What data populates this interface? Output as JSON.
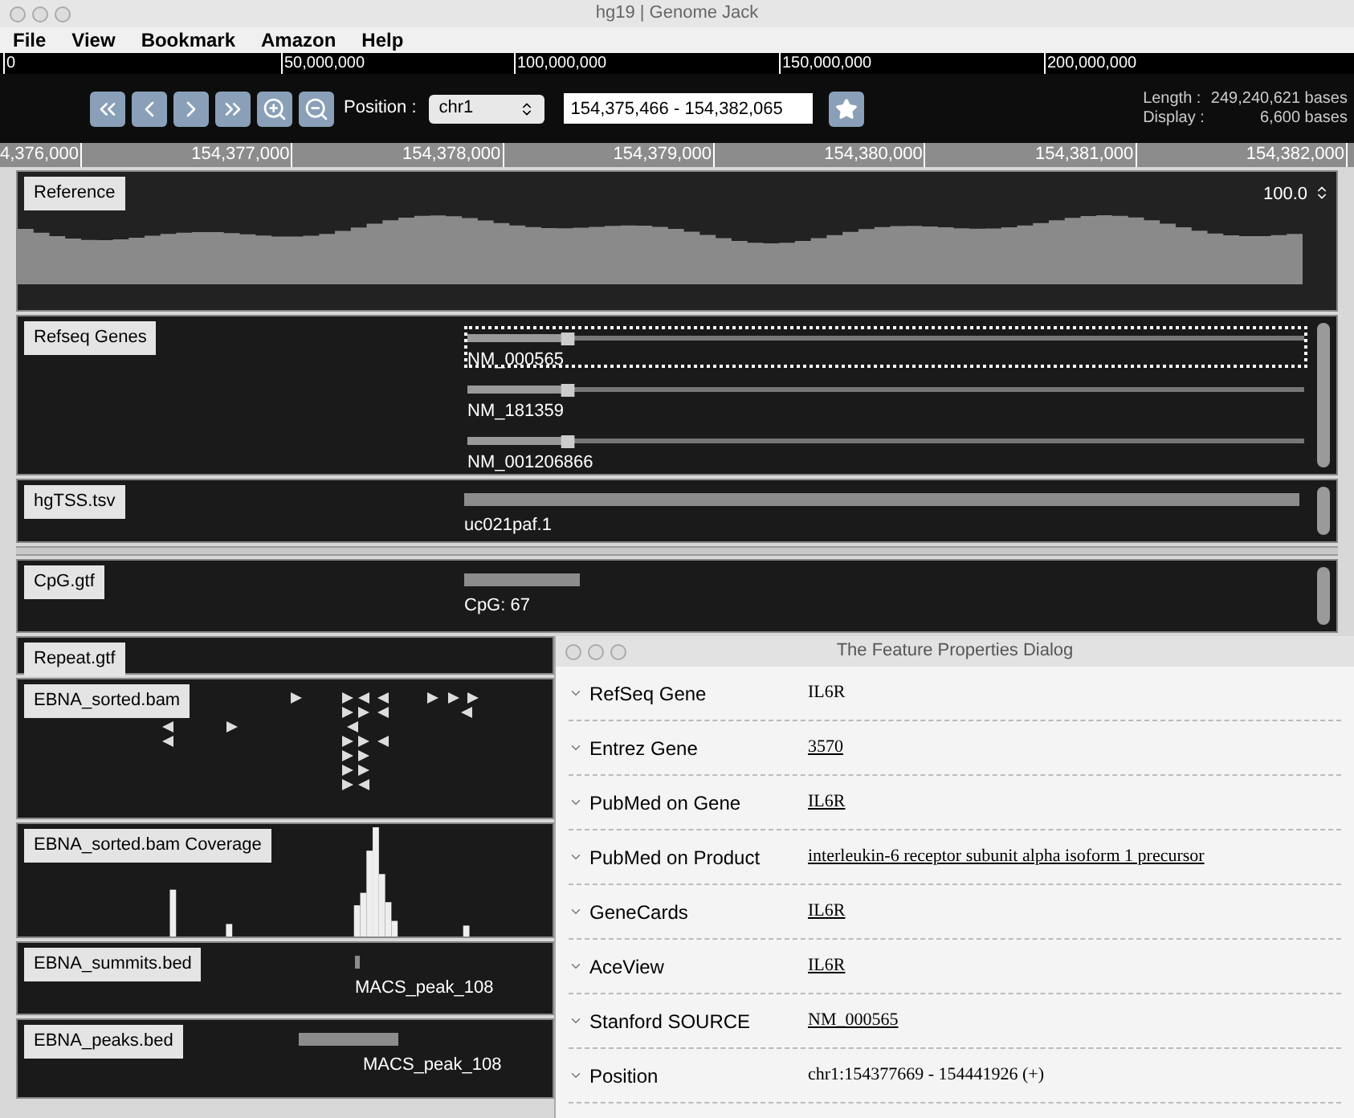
{
  "window": {
    "title": "hg19 | Genome Jack"
  },
  "menu": [
    "File",
    "View",
    "Bookmark",
    "Amazon",
    "Help"
  ],
  "genome_ruler": [
    "0",
    "50,000,000",
    "100,000,000",
    "150,000,000",
    "200,000,000"
  ],
  "toolbar": {
    "position_label": "Position :",
    "chromosome": "chr1",
    "range": "154,375,466 - 154,382,065",
    "length_label": "Length :",
    "length": "249,240,621 bases",
    "display_label": "Display :",
    "display": "6,600 bases"
  },
  "region_ruler": [
    "4,376,000",
    "154,377,000",
    "154,378,000",
    "154,379,000",
    "154,380,000",
    "154,381,000",
    "154,382,000"
  ],
  "tracks": [
    {
      "kind": "reference",
      "name": "Reference",
      "max": "100.0"
    },
    {
      "kind": "genes",
      "name": "Refseq Genes",
      "features": [
        {
          "label": "NM_000565",
          "selected": true
        },
        {
          "label": "NM_181359",
          "selected": false
        },
        {
          "label": "NM_001206866",
          "selected": false
        }
      ]
    },
    {
      "kind": "bed",
      "name": "hgTSS.tsv",
      "features": [
        {
          "label": "uc021paf.1"
        }
      ]
    },
    {
      "kind": "bed",
      "name": "CpG.gtf",
      "features": [
        {
          "label": "CpG: 67"
        }
      ]
    }
  ],
  "lower_tracks": [
    {
      "kind": "empty",
      "name": "Repeat.gtf"
    },
    {
      "kind": "reads",
      "name": "EBNA_sorted.bam"
    },
    {
      "kind": "coverage",
      "name": "EBNA_sorted.bam Coverage"
    },
    {
      "kind": "bed",
      "name": "EBNA_summits.bed",
      "features": [
        {
          "label": "MACS_peak_108"
        }
      ]
    },
    {
      "kind": "bed",
      "name": "EBNA_peaks.bed",
      "features": [
        {
          "label": "MACS_peak_108"
        }
      ]
    }
  ],
  "dialog": {
    "title": "The Feature Properties Dialog",
    "properties": [
      {
        "label": "RefSeq Gene",
        "value": "IL6R",
        "link": false
      },
      {
        "label": "Entrez Gene",
        "value": "3570",
        "link": true
      },
      {
        "label": "PubMed on Gene",
        "value": "IL6R",
        "link": true
      },
      {
        "label": "PubMed on Product",
        "value": "interleukin-6 receptor subunit alpha isoform 1 precursor",
        "link": true
      },
      {
        "label": "GeneCards",
        "value": "IL6R",
        "link": true
      },
      {
        "label": "AceView",
        "value": "IL6R",
        "link": true
      },
      {
        "label": "Stanford SOURCE",
        "value": "NM_000565",
        "link": true
      },
      {
        "label": "Position",
        "value": "chr1:154377669 - 154441926 (+)",
        "link": false
      }
    ]
  }
}
